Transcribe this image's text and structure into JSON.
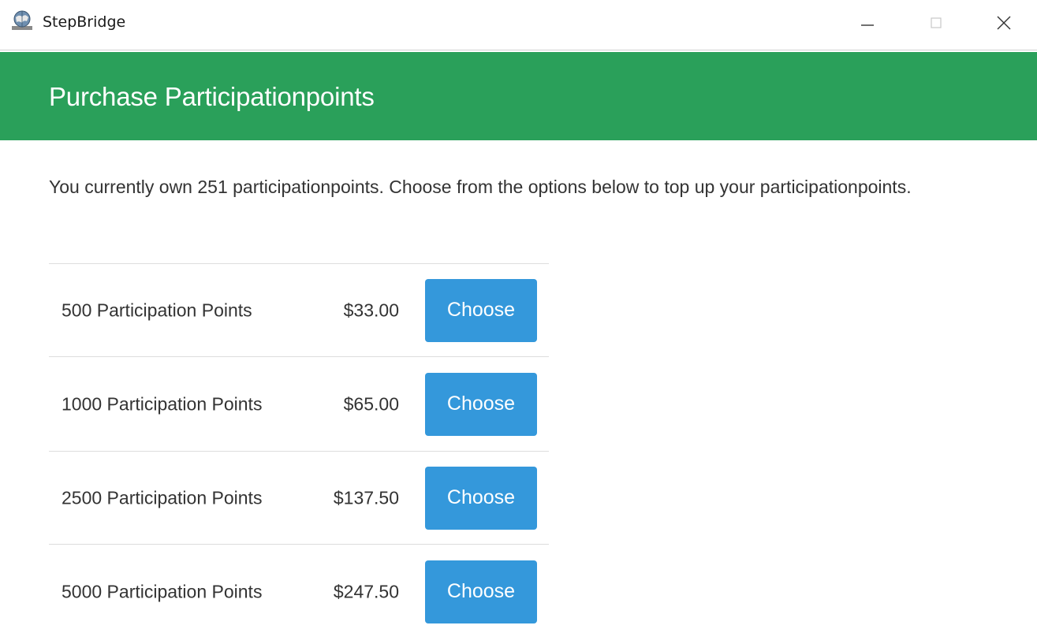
{
  "window": {
    "title": "StepBridge",
    "icon": "stepbridge-globe-icon",
    "controls": {
      "minimize_icon": "minimize-icon",
      "maximize_icon": "maximize-icon",
      "close_icon": "close-icon"
    }
  },
  "header": {
    "title": "Purchase Participationpoints",
    "background_color": "#2aa05a"
  },
  "intro": {
    "text": "You currently own 251 participationpoints. Choose from the options below to top up your participationpoints."
  },
  "options": [
    {
      "label": "500 Participation Points",
      "price": "$33.00",
      "button_label": "Choose"
    },
    {
      "label": "1000 Participation Points",
      "price": "$65.00",
      "button_label": "Choose"
    },
    {
      "label": "2500 Participation Points",
      "price": "$137.50",
      "button_label": "Choose"
    },
    {
      "label": "5000 Participation Points",
      "price": "$247.50",
      "button_label": "Choose"
    }
  ],
  "colors": {
    "button": "#3498db",
    "button_text": "#ffffff",
    "header_text": "#ffffff",
    "body_text": "#333333"
  }
}
